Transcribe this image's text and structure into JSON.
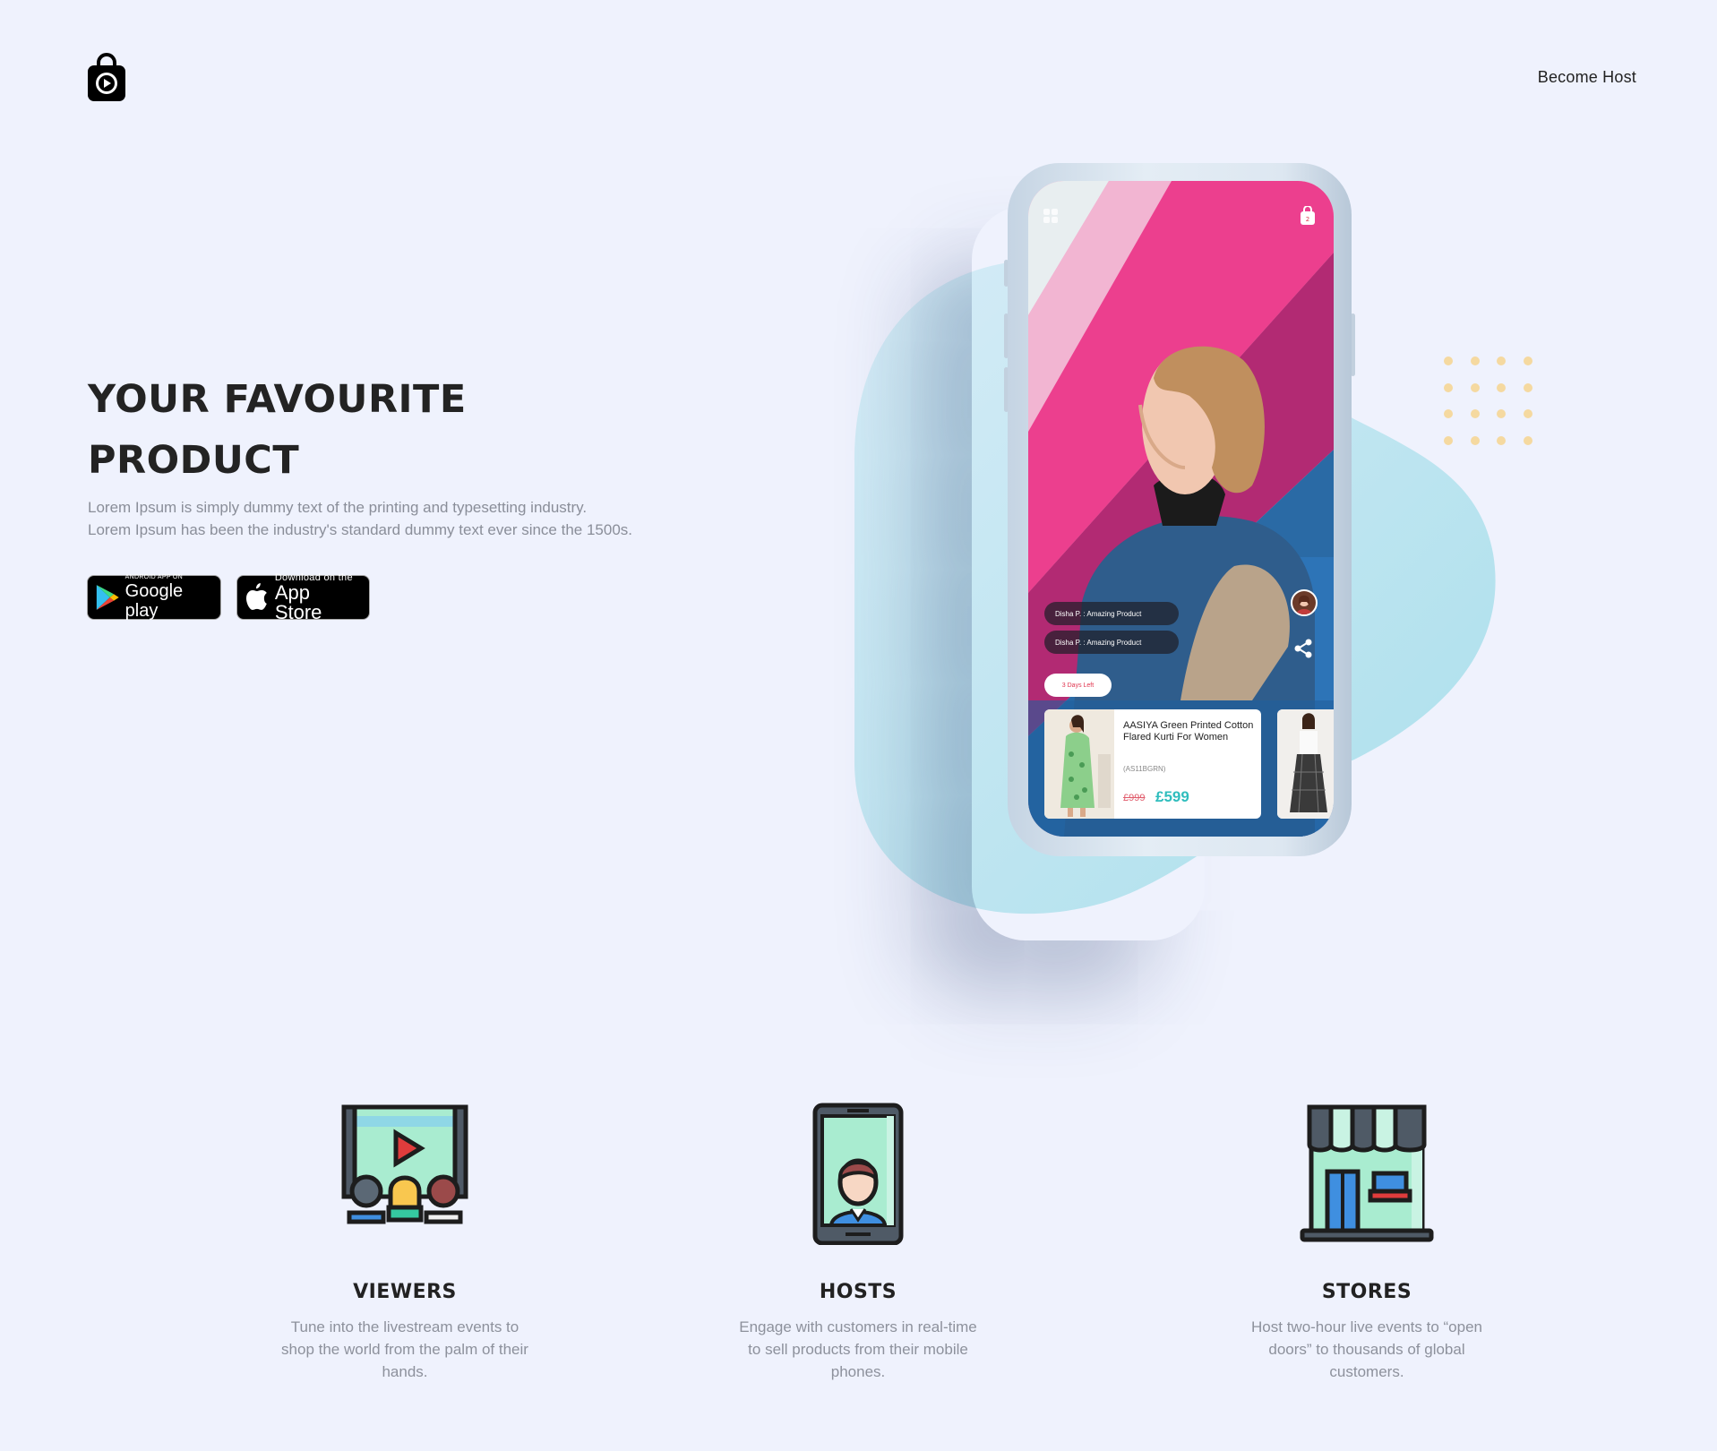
{
  "header": {
    "logo_icon": "shopping-bag-play-icon",
    "become_host": "Become Host"
  },
  "hero": {
    "title_line1": "YOUR FAVOURITE",
    "title_line2": "PRODUCT",
    "desc_line1": "Lorem Ipsum is simply dummy text of the printing and typesetting industry.",
    "desc_line2": "Lorem Ipsum has been the industry's standard dummy text ever since the 1500s."
  },
  "stores": {
    "google_small": "ANDROID APP ON",
    "google_big": "Google play",
    "apple_small": "Download on the",
    "apple_big": "App Store"
  },
  "phone": {
    "bag_count": "2",
    "chat1": "Disha P. : Amazing Product",
    "chat2": "Disha P. : Amazing Product",
    "days_left": "3 Days Left",
    "product": {
      "name": "AASIYA Green Printed Cotton Flared Kurti For Women",
      "code": "(AS11BGRN)",
      "old_price": "£999",
      "new_price": "£599"
    }
  },
  "features": [
    {
      "icon": "viewers-screen-icon",
      "title": "VIEWERS",
      "desc": "Tune into the livestream events to shop the world from the palm of their hands."
    },
    {
      "icon": "host-phone-icon",
      "title": "HOSTS",
      "desc": "Engage with customers in real-time to sell products from their mobile phones."
    },
    {
      "icon": "store-front-icon",
      "title": "STORES",
      "desc": "Host two-hour live events to “open doors” to thousands of global customers."
    }
  ],
  "colors": {
    "background": "#eff2fd",
    "blob": "#b7e2f0",
    "price": "#2fbdbd",
    "dots": "#f5d9a0"
  }
}
